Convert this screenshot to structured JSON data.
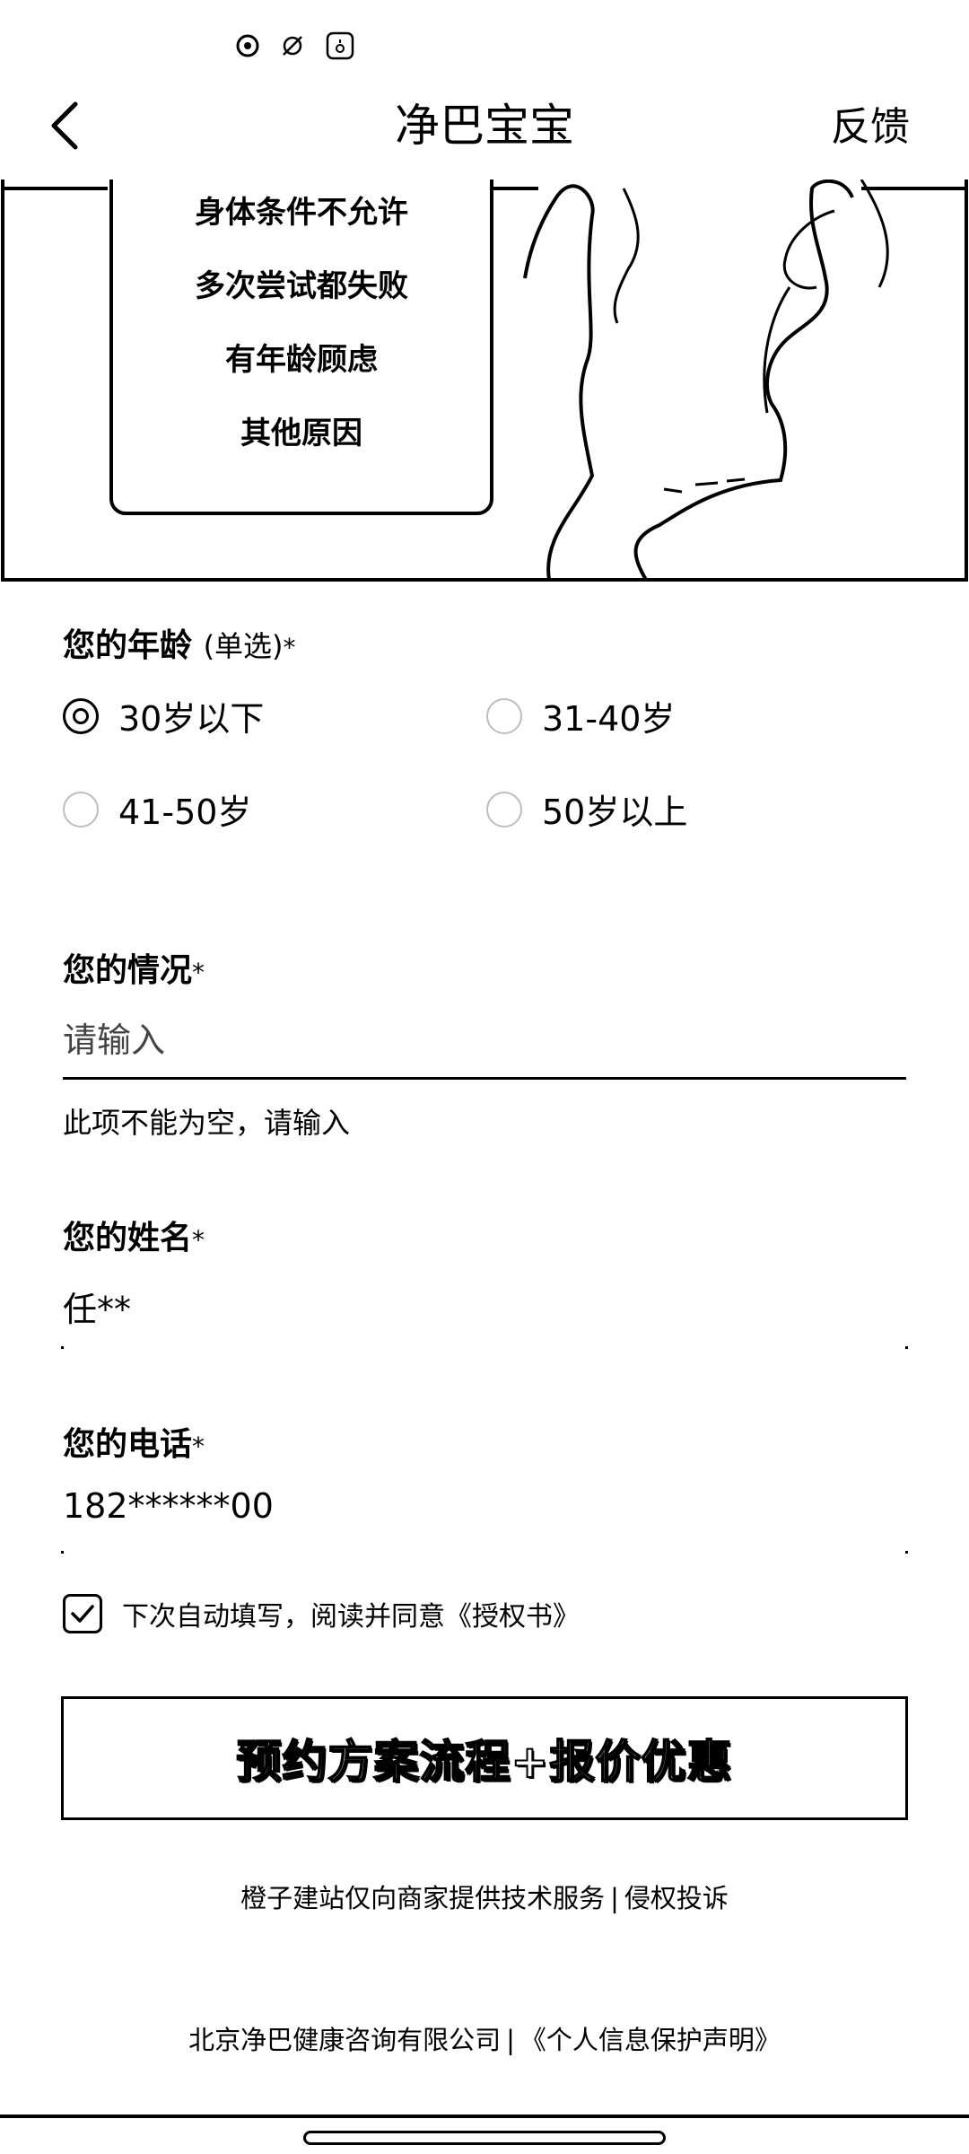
{
  "header": {
    "title": "净巴宝宝",
    "feedback_label": "反馈"
  },
  "banner": {
    "reasons": [
      "身体条件不允许",
      "多次尝试都失败",
      "有年龄顾虑",
      "其他原因"
    ]
  },
  "age": {
    "label": "您的年龄",
    "hint": "(单选)",
    "required_mark": "*",
    "options": [
      {
        "label": "30岁以下",
        "selected": true
      },
      {
        "label": "31-40岁",
        "selected": false
      },
      {
        "label": "41-50岁",
        "selected": false
      },
      {
        "label": "50岁以上",
        "selected": false
      }
    ]
  },
  "situation": {
    "label": "您的情况",
    "required_mark": "*",
    "placeholder": "请输入",
    "error": "此项不能为空，请输入"
  },
  "name": {
    "label": "您的姓名",
    "required_mark": "*",
    "value": "任**"
  },
  "phone": {
    "label": "您的电话",
    "required_mark": "*",
    "value": "182******00"
  },
  "consent": {
    "checked": true,
    "text": "下次自动填写，阅读并同意《授权书》"
  },
  "submit_label": "预约方案流程+报价优惠",
  "footer": {
    "line1_left": "橙子建站仅向商家提供技术服务",
    "line1_sep": "|",
    "line1_right": "侵权投诉",
    "line2_left": "北京净巴健康咨询有限公司",
    "line2_sep": "|",
    "line2_right": "《个人信息保护声明》"
  }
}
